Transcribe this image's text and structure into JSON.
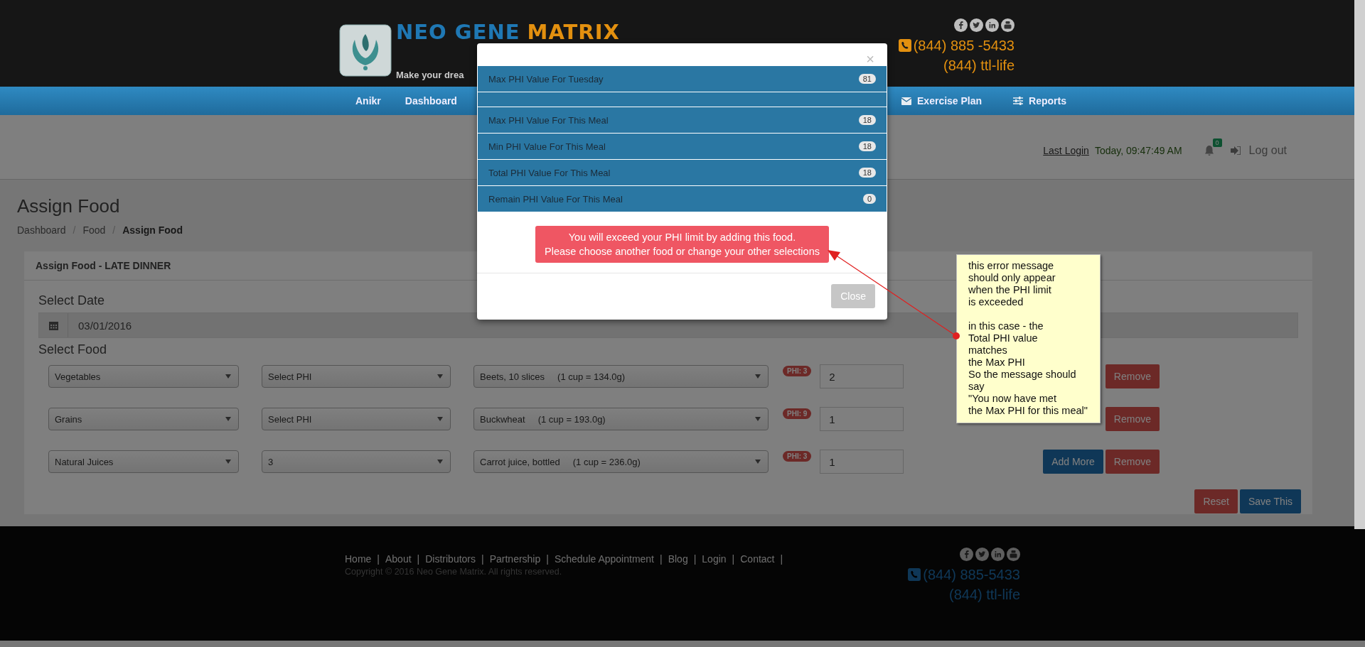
{
  "header": {
    "logo_words": [
      {
        "text": "NEO GENE",
        "color": "#1f78b4"
      },
      {
        "text": "MATRIX",
        "color": "#e3900f"
      }
    ],
    "tagline": "Make your drea",
    "phone": "(844) 885 -5433",
    "phone_alt": "(844) ttl-life"
  },
  "nav": {
    "items": [
      {
        "label": "Anikr",
        "kind": "plain"
      },
      {
        "label": "Dashboard",
        "kind": "plain"
      },
      {
        "label": "Exercise Plan",
        "kind": "envelope"
      },
      {
        "label": "Reports",
        "kind": "sliders"
      }
    ]
  },
  "userbar": {
    "last_login_label": "Last Login",
    "last_login_value": "Today, 09:47:49 AM",
    "notifications": "0",
    "logout": "Log out"
  },
  "page": {
    "title": "Assign Food",
    "breadcrumb_separator": "/",
    "breadcrumb": [
      {
        "label": "Dashboard",
        "current": false
      },
      {
        "label": "Food",
        "current": false
      },
      {
        "label": "Assign Food",
        "current": true
      }
    ]
  },
  "panel": {
    "title": "Assign Food - LATE DINNER",
    "date_label": "Select Date",
    "date_value": "03/01/2016",
    "food_label": "Select Food",
    "rows": [
      {
        "group": "Vegetables",
        "phi": "Select PHI",
        "food": "Beets, 10 slices     (1 cup = 134.0g)",
        "phi_badge": "PHI: 3",
        "quantity": "2",
        "remove": "Remove"
      },
      {
        "group": "Grains",
        "phi": "Select PHI",
        "food": "Buckwheat     (1 cup = 193.0g)",
        "phi_badge": "PHI: 9",
        "quantity": "1",
        "remove": "Remove"
      },
      {
        "group": "Natural Juices",
        "phi": "3",
        "food": "Carrot juice, bottled     (1 cup = 236.0g)",
        "phi_badge": "PHI: 3",
        "quantity": "1",
        "add_more": "Add More",
        "remove": "Remove"
      }
    ],
    "reset": "Reset",
    "save": "Save This"
  },
  "modal": {
    "close_mark": "×",
    "items": [
      {
        "kind": "value",
        "label": "Max PHI Value For Tuesday",
        "value": "81"
      },
      {
        "kind": "blank"
      },
      {
        "kind": "value",
        "label": "Max PHI Value For This Meal",
        "value": "18"
      },
      {
        "kind": "value",
        "label": "Min PHI Value For This Meal",
        "value": "18"
      },
      {
        "kind": "value",
        "label": "Total PHI Value For This Meal",
        "value": "18"
      },
      {
        "kind": "value",
        "label": "Remain PHI Value For This Meal",
        "value": "0"
      }
    ],
    "alert_lines": [
      "You will exceed your PHI limit by adding this food.",
      "Please choose another food or change your other selections"
    ],
    "close_button": "Close"
  },
  "note": {
    "paragraphs": [
      [
        "this error message",
        "should only appear",
        "when the PHI limit",
        "is exceeded"
      ],
      [
        "in this case - the",
        "Total PHI value",
        "matches",
        "the Max PHI",
        "So the message should",
        "say",
        "\"You now have met",
        "the Max PHI for this meal\""
      ]
    ]
  },
  "footer": {
    "link_separator": "|",
    "links": [
      "Home",
      "About",
      "Distributors",
      "Partnership",
      "Schedule Appointment",
      "Blog",
      "Login",
      "Contact"
    ],
    "copyright": "Copyright © 2016 Neo Gene Matrix. All rights reserved.",
    "phone": "(844) 885-5433",
    "phone_alt": "(844) ttl-life"
  }
}
